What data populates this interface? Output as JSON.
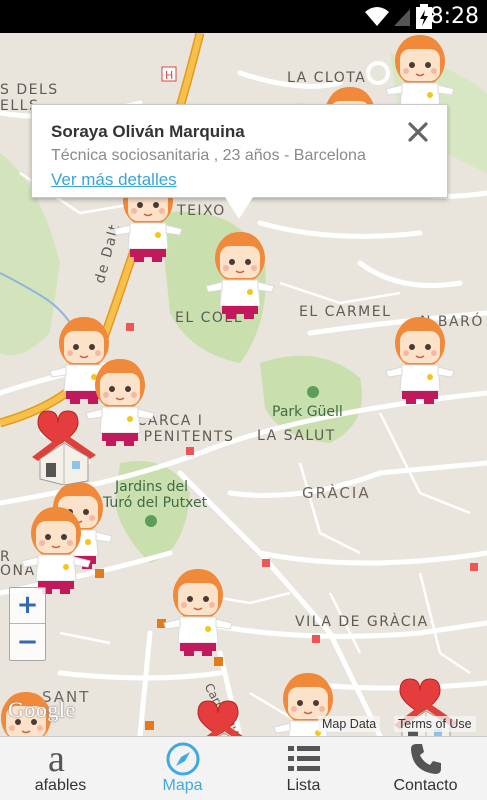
{
  "status_bar": {
    "time": "8:28"
  },
  "map": {
    "labels": {
      "dels_top": "S DELS",
      "dels_bottom": "ELLS",
      "la_clota": "LA CLOTA",
      "teixo": "A TEIXO",
      "dalt": "de Dalt",
      "el_coll": "EL COLL",
      "el_carmel": "EL CARMEL",
      "baro": "N BARÓ",
      "vallcarca": "LLCARCA I",
      "penitents": "LS PENITENTS",
      "park_guell": "Park Güell",
      "la_salut": "LA SALUT",
      "jardins_1": "Jardins del",
      "jardins_2": "Turó del Putxet",
      "gracia": "GRÀCIA",
      "vila_gracia": "VILA DE GRÀCIA",
      "r_left": "R",
      "onan": "ONAN",
      "sant": "SANT",
      "carrer": "Carrer d'Alfons"
    },
    "info_window": {
      "name": "Soraya Oliván Marquina",
      "description": "Técnica sociosanitaria , 23 años - Barcelona",
      "link": "Ver más detalles"
    },
    "zoom": {
      "in": "+",
      "out": "−"
    },
    "logo": "Google",
    "map_data": "Map Data",
    "terms": "Terms of Use"
  },
  "nav": [
    {
      "label": "afables",
      "icon": "afables-logo-icon"
    },
    {
      "label": "Mapa",
      "icon": "compass-icon"
    },
    {
      "label": "Lista",
      "icon": "list-icon"
    },
    {
      "label": "Contacto",
      "icon": "phone-icon"
    }
  ],
  "colors": {
    "accent": "#3fa9e4",
    "map_bg": "#e9e5dc",
    "park": "#c9dfae",
    "road_major": "#f7b73a",
    "marker_hair": "#f08a3a",
    "marker_skirt": "#c2195c"
  }
}
